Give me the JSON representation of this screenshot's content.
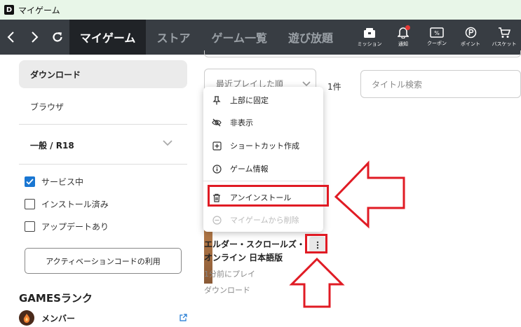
{
  "window": {
    "app_icon": "D",
    "title": "マイゲーム"
  },
  "nav": {
    "tabs": [
      {
        "label": "マイゲーム",
        "active": true
      },
      {
        "label": "ストア",
        "active": false
      },
      {
        "label": "ゲーム一覧",
        "active": false
      },
      {
        "label": "遊び放題",
        "active": false
      }
    ],
    "icons": [
      {
        "icon": "mission-icon",
        "label": "ミッション"
      },
      {
        "icon": "bell-icon",
        "label": "通知",
        "has_badge": true
      },
      {
        "icon": "coupon-icon",
        "label": "クーポン"
      },
      {
        "icon": "points-icon",
        "label": "ポイント"
      },
      {
        "icon": "cart-icon",
        "label": "バスケット"
      }
    ]
  },
  "sidebar": {
    "items": [
      {
        "label": "ダウンロード",
        "selected": true
      },
      {
        "label": "ブラウザ",
        "selected": false
      }
    ],
    "filter": {
      "label": "一般 / R18"
    },
    "checkboxes": [
      {
        "label": "サービス中",
        "checked": true
      },
      {
        "label": "インストール済み",
        "checked": false
      },
      {
        "label": "アップデートあり",
        "checked": false
      }
    ],
    "activation_button": "アクティベーションコードの利用",
    "rank_heading": "GAMESランク",
    "member_label": "メンバー"
  },
  "main": {
    "sort_label": "最近プレイした順",
    "result_count": "1件",
    "search_placeholder": "タイトル検索",
    "game": {
      "title_line1": "エルダー・スクロールズ・",
      "title_line2": "オンライン 日本語版",
      "last_played": "1分前にプレイ",
      "status": "ダウンロード"
    }
  },
  "context_menu": {
    "items": [
      {
        "icon": "pin-icon",
        "label": "上部に固定",
        "disabled": false
      },
      {
        "icon": "eye-off-icon",
        "label": "非表示",
        "disabled": false
      },
      {
        "icon": "plus-square-icon",
        "label": "ショートカット作成",
        "disabled": false
      },
      {
        "icon": "info-icon",
        "label": "ゲーム情報",
        "disabled": false
      },
      {
        "icon": "trash-icon",
        "label": "アンインストール",
        "disabled": false,
        "highlighted": true
      },
      {
        "icon": "minus-circle-icon",
        "label": "マイゲームから削除",
        "disabled": true
      }
    ]
  },
  "annotation_color": "#e01b24",
  "colors": {
    "navbar": "#383d43",
    "nav_active": "#202327",
    "checkbox_accent": "#1976d2",
    "titlebar": "#e8f6e8"
  }
}
